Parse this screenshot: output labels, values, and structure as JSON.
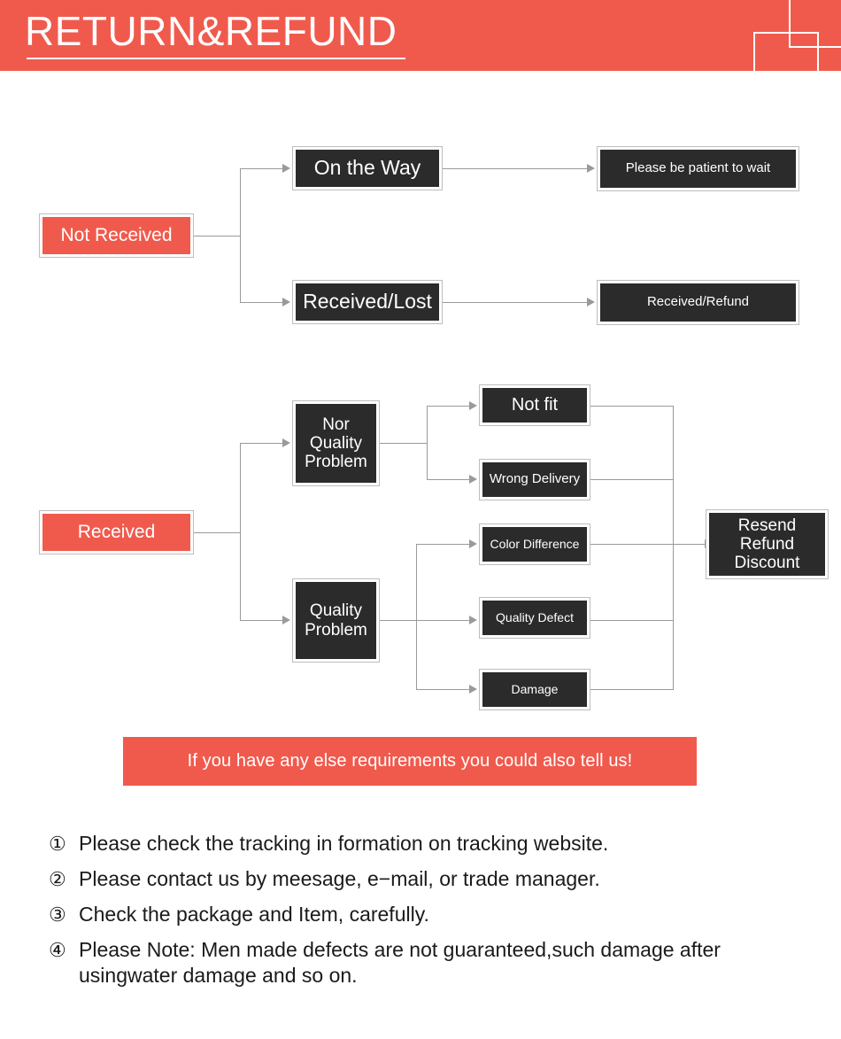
{
  "header": {
    "title": "RETURN&REFUND"
  },
  "flow_not_received": {
    "source": "Not Received",
    "branches": [
      {
        "stage": "On the Way",
        "result": "Please be patient to wait"
      },
      {
        "stage": "Received/Lost",
        "result": "Received/Refund"
      }
    ]
  },
  "flow_received": {
    "source": "Received",
    "categories": [
      {
        "name": "Nor Quality Problem",
        "reasons": [
          "Not fit",
          "Wrong Delivery"
        ]
      },
      {
        "name": "Quality Problem",
        "reasons": [
          "Color Difference",
          "Quality Defect",
          "Damage"
        ]
      }
    ],
    "outcome": "Resend Refund Discount"
  },
  "boxes": {
    "not_received": "Not Received",
    "on_the_way": "On the Way",
    "please_wait": "Please be patient to wait",
    "received_lost": "Received/Lost",
    "received_refund": "Received/Refund",
    "received": "Received",
    "nor_quality_problem": "Nor\nQuality\nProblem",
    "quality_problem": "Quality\nProblem",
    "not_fit": "Not fit",
    "wrong_delivery": "Wrong Delivery",
    "color_difference": "Color Difference",
    "quality_defect": "Quality Defect",
    "damage": "Damage",
    "resend_refund_discount": "Resend\nRefund\nDiscount"
  },
  "banner": {
    "text": "If you have any else requirements you could also tell us!"
  },
  "notes": [
    {
      "num": "①",
      "text": "Please check the tracking in formation on tracking website."
    },
    {
      "num": "②",
      "text": "Please contact us by meesage, e−mail, or trade manager."
    },
    {
      "num": "③",
      "text": "Check the package and Item, carefully."
    },
    {
      "num": "④",
      "text": "Please Note: Men made defects are not guaranteed,such damage after usingwater damage and so on."
    }
  ],
  "colors": {
    "brand_red": "#F05A4D",
    "box_dark": "#2B2B2B",
    "box_border": "#BDBDBD",
    "connector": "#9A9A9A"
  }
}
